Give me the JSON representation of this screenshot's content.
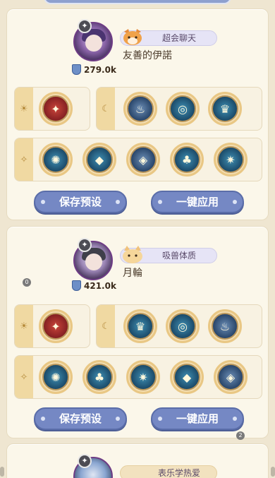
{
  "presets": [
    {
      "pet_tag": "超会聊天",
      "cookie_name": "友善的伊諾",
      "power": "279.0k",
      "buttons": {
        "save": "保存预设",
        "apply": "一键应用"
      }
    },
    {
      "pet_tag": "吸兽体质",
      "cookie_name": "月輪",
      "power": "421.0k",
      "buttons": {
        "save": "保存预设",
        "apply": "一键应用"
      }
    },
    {
      "pet_tag": "表乐学热爱"
    }
  ],
  "badges": {
    "card2_left": "0",
    "card2_right": "2"
  },
  "icons": {
    "sun": "sun-icon",
    "moon": "moon-icon",
    "star": "star-icon",
    "rank": "rank-emblem-icon",
    "power": "power-shield-icon"
  },
  "colors": {
    "button": "#7588c4",
    "background": "#efe6d1",
    "card": "#fbf7ea"
  }
}
